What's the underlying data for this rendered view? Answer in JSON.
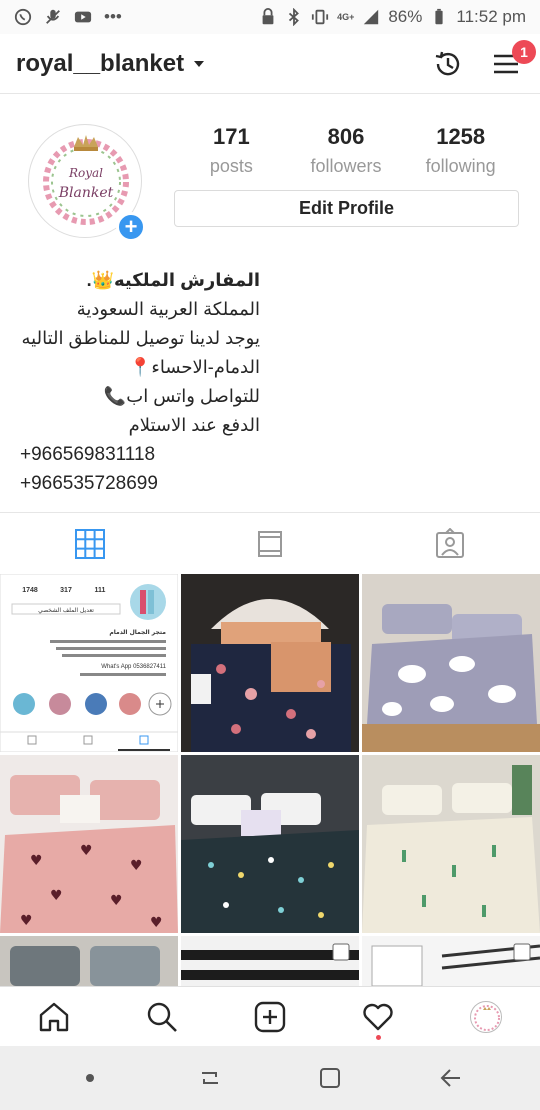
{
  "status_bar": {
    "left_icons": [
      "whatsapp-icon",
      "mic-off-icon",
      "youtube-icon",
      "more-dots-icon"
    ],
    "network": "4G+",
    "battery": "86%",
    "time": "11:52 pm"
  },
  "header": {
    "username": "royal__blanket",
    "notification_count": "1"
  },
  "profile": {
    "avatar_text_line1": "Royal",
    "avatar_text_line2": "Blanket",
    "stats": [
      {
        "value": "171",
        "label": "posts"
      },
      {
        "value": "806",
        "label": "followers"
      },
      {
        "value": "1258",
        "label": "following"
      }
    ],
    "edit_profile_label": "Edit Profile"
  },
  "bio": {
    "name": "المفارش الملكيه👑.",
    "lines": [
      "المملكة العربية السعودية",
      "يوجد لدينا توصيل للمناطق التاليه",
      "الدمام-الاحساء📍",
      "للتواصل واتس اب📞",
      "الدفع عند الاستلام"
    ],
    "phones": [
      "+966569831118",
      "+966535728699"
    ]
  },
  "tabs": [
    {
      "name": "grid-view-icon",
      "active": true
    },
    {
      "name": "feed-view-icon",
      "active": false
    },
    {
      "name": "tagged-photos-icon",
      "active": false
    }
  ],
  "posts": {
    "thumbnail_text": {
      "stats": [
        "1748",
        "317",
        "111"
      ],
      "button": "تعديل الملف الشخصي",
      "title": "متجر الجمال الدمام",
      "whatsapp": "What's App 0536827411"
    }
  },
  "colors": {
    "accent": "#3897f0",
    "badge": "#ed4956",
    "text": "#262626",
    "muted": "#999999"
  }
}
